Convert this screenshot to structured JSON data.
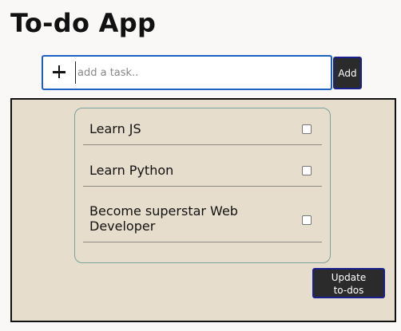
{
  "app": {
    "title": "To-do App"
  },
  "input": {
    "icon": "plus-icon",
    "placeholder": "add a task..",
    "value": "",
    "add_label": "Add"
  },
  "todos": [
    {
      "text": "Learn JS",
      "checked": false
    },
    {
      "text": "Learn Python",
      "checked": false
    },
    {
      "text": "Become superstar Web Developer",
      "checked": false
    }
  ],
  "update_label": "Update to-dos",
  "colors": {
    "page_background": "#f9f8f6",
    "panel_background": "#e6ddcc",
    "button_background": "#2b2b2b",
    "button_border": "#1a1f8f",
    "input_focus_border": "#1d61c4",
    "card_border": "#7aa39b"
  }
}
